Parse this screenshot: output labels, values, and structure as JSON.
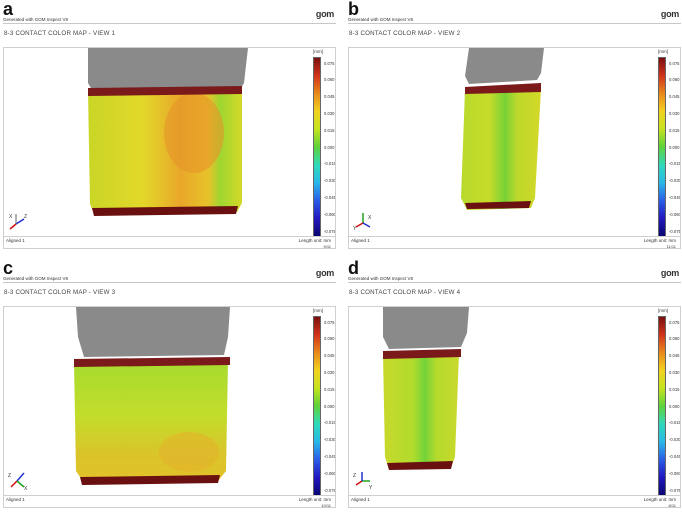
{
  "header": {
    "generated_text": "Generated with GOM Inspect V8",
    "logo_text": "gom"
  },
  "footer": {
    "aligned_text": "Aligned 1",
    "length_unit_text": "Length unit: mm"
  },
  "scale": {
    "unit": "[mm]",
    "ticks": [
      "0.075",
      "0.060",
      "0.045",
      "0.030",
      "0.015",
      "0.000",
      "-0.015",
      "-0.030",
      "-0.045",
      "-0.060",
      "-0.075"
    ],
    "gradient_colors": [
      "#7a1010",
      "#d2331c",
      "#e8891c",
      "#f2d21f",
      "#c4e31f",
      "#5fd23a",
      "#2ed9ba",
      "#29b9e8",
      "#2a5ee6",
      "#2218c0",
      "#0a0670"
    ]
  },
  "panels": [
    {
      "letter": "a",
      "title": "8-3 CONTACT COLOR MAP - VIEW 1",
      "page": "9/11"
    },
    {
      "letter": "b",
      "title": "8-3 CONTACT COLOR MAP - VIEW 2",
      "page": "11/11"
    },
    {
      "letter": "c",
      "title": "8-3 CONTACT COLOR MAP - VIEW 3",
      "page": "10/11"
    },
    {
      "letter": "d",
      "title": "8-3 CONTACT COLOR MAP - VIEW 4",
      "page": "8/11"
    }
  ],
  "axis_labels": {
    "x": "X",
    "y": "Y",
    "z": "Z"
  }
}
